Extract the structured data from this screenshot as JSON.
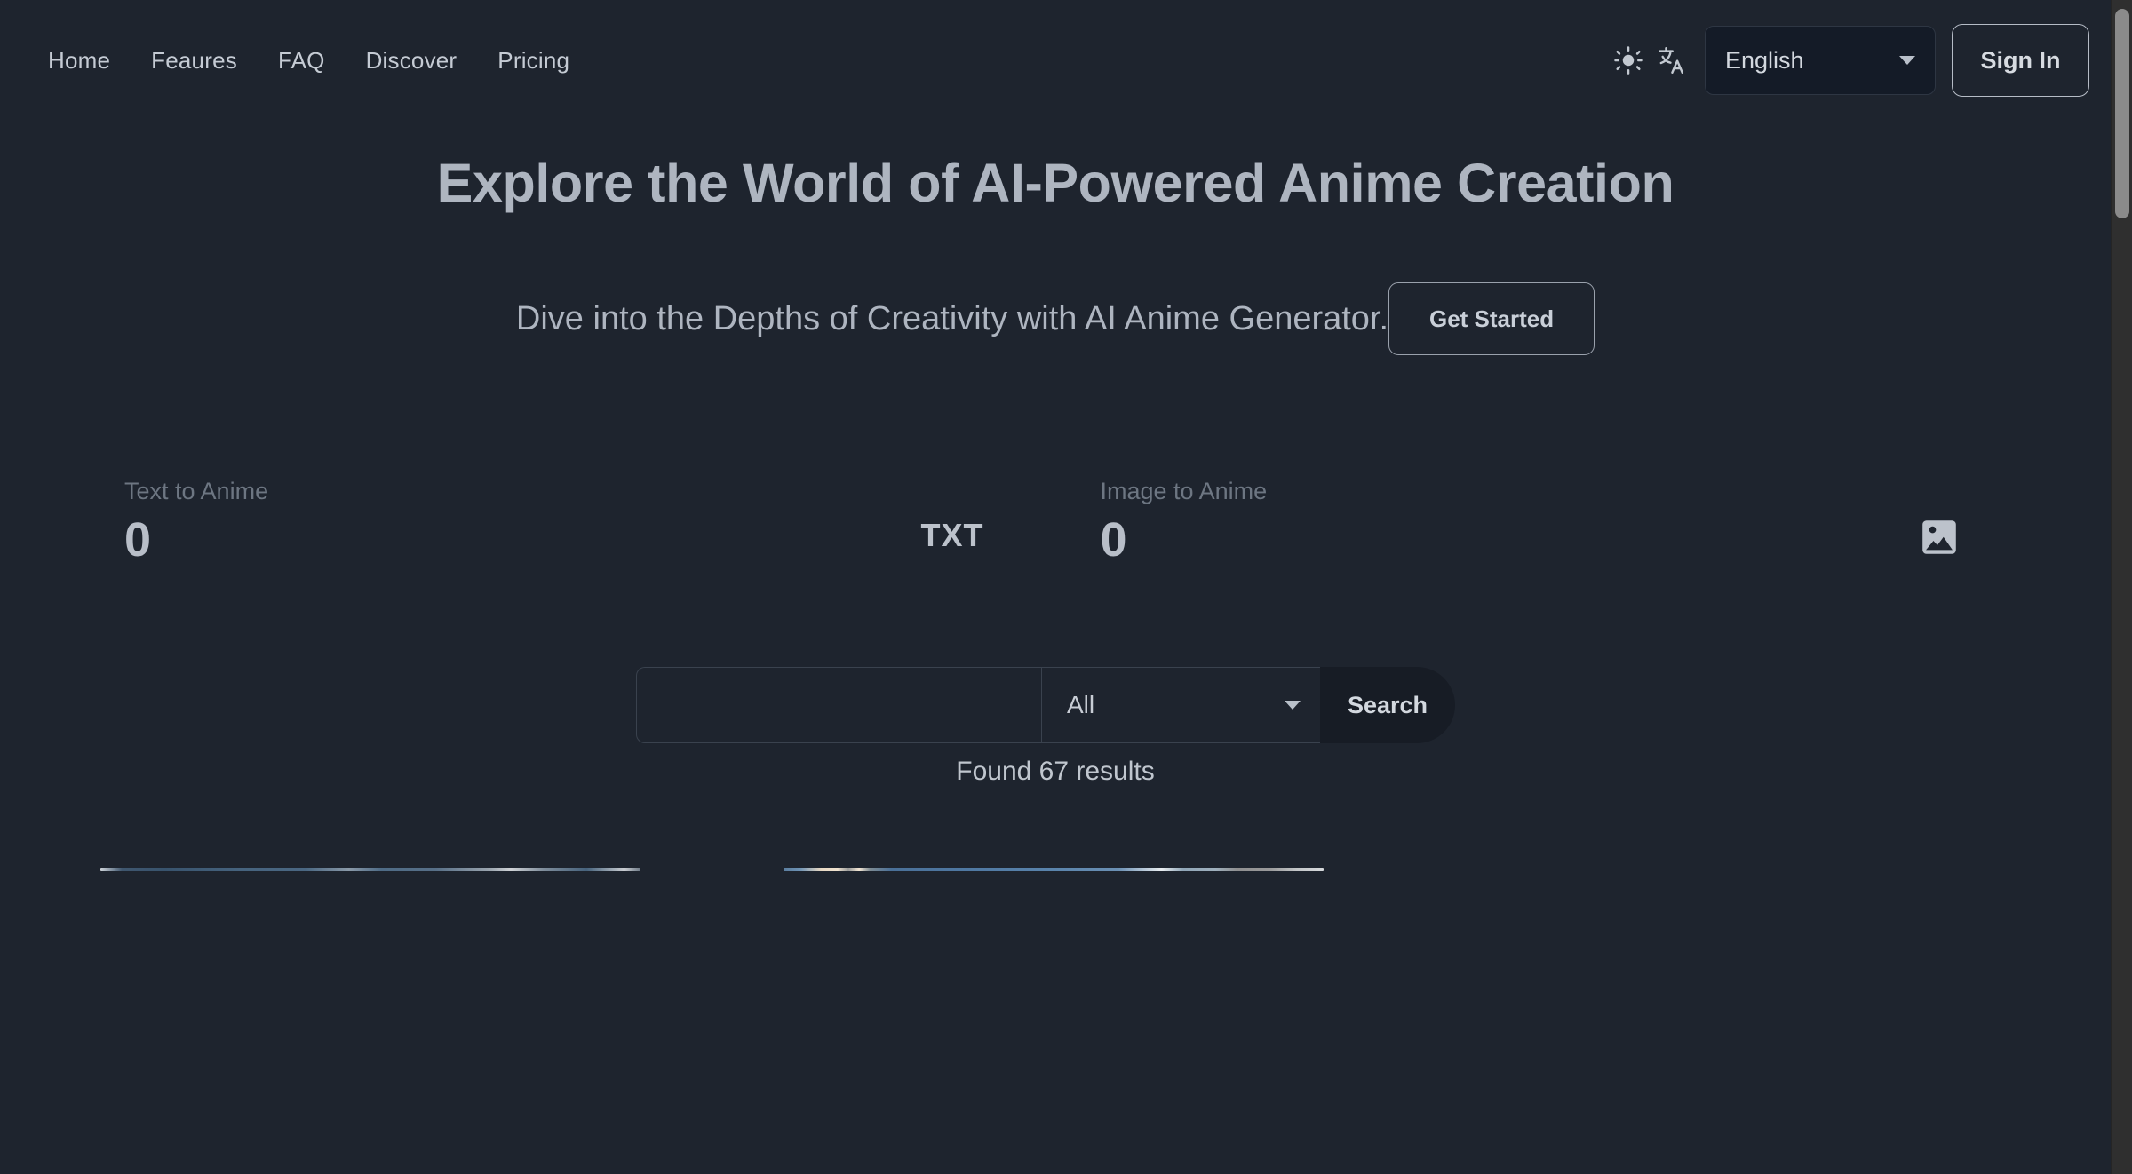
{
  "nav": {
    "items": [
      {
        "label": "Home",
        "name": "nav-link-home"
      },
      {
        "label": "Feaures",
        "name": "nav-link-feaures"
      },
      {
        "label": "FAQ",
        "name": "nav-link-faq"
      },
      {
        "label": "Discover",
        "name": "nav-link-discover"
      },
      {
        "label": "Pricing",
        "name": "nav-link-pricing"
      }
    ],
    "theme_toggle_icon": "sun-icon",
    "translate_icon": "translate-icon",
    "language": {
      "selected": "English",
      "options": [
        "English"
      ]
    },
    "sign_in_label": "Sign In"
  },
  "hero": {
    "title": "Explore the World of AI-Powered Anime Creation",
    "subtitle": "Dive into the Depths of Creativity with AI Anime Generator.",
    "cta_label": "Get Started"
  },
  "stats": [
    {
      "label": "Text to Anime",
      "value": "0",
      "icon": "txt-file-icon",
      "icon_text": "TXT"
    },
    {
      "label": "Image to Anime",
      "value": "0",
      "icon": "image-icon",
      "icon_text": ""
    }
  ],
  "search": {
    "query": "",
    "placeholder": "",
    "category_selected": "All",
    "category_options": [
      "All"
    ],
    "button_label": "Search",
    "results_text": "Found 67 results"
  },
  "colors": {
    "background": "#1e242e",
    "text_primary": "#c5cbd4",
    "text_muted": "#6d7682",
    "border": "#3a424e",
    "select_fill": "#141b27",
    "search_button_fill": "#171c25",
    "scrollbar_track": "#2f2f2f",
    "scrollbar_thumb": "#8b8b8b"
  }
}
